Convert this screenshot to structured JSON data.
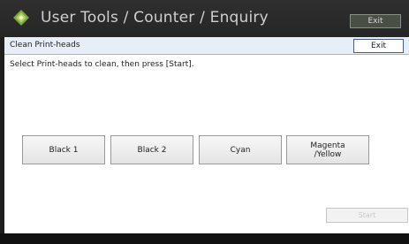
{
  "titlebar": {
    "title": "User Tools / Counter / Enquiry",
    "exit_label": "Exit",
    "logo_icon": "diamond-logo-icon"
  },
  "header": {
    "title": "Clean Print-heads",
    "exit_label": "Exit"
  },
  "instruction": "Select Print-heads to clean, then press [Start].",
  "print_heads": [
    {
      "label": "Black 1"
    },
    {
      "label": "Black 2"
    },
    {
      "label": "Cyan"
    },
    {
      "label": "Magenta\n/Yellow"
    }
  ],
  "start_label": "Start",
  "colors": {
    "titlebar_bg": "#2a2a2a",
    "logo_green": "#7ea83a",
    "header_bg": "#e7eef7",
    "start_disabled_text": "#c8c8c8"
  }
}
